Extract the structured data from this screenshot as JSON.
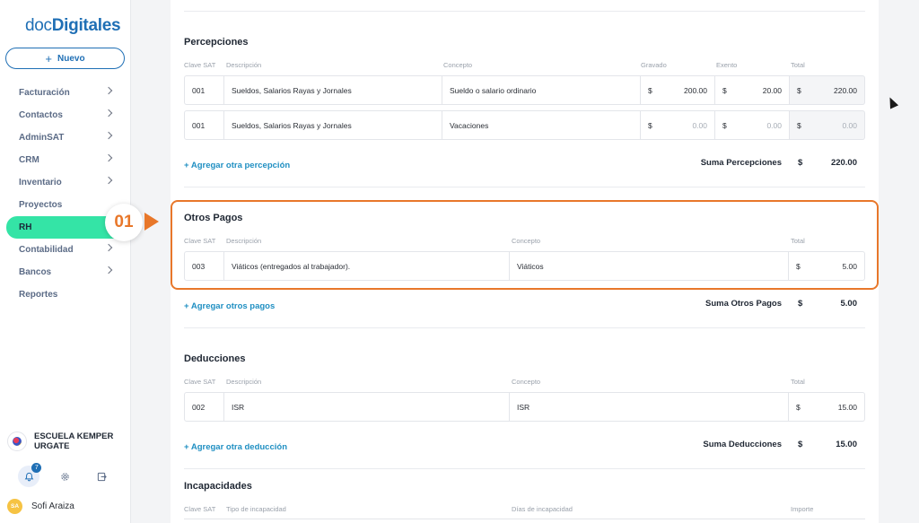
{
  "app": {
    "logo_part1": "doc",
    "logo_part2": "Digitales",
    "new_button": "Nuevo"
  },
  "sidebar": {
    "items": [
      {
        "label": "Facturación",
        "chevron": true
      },
      {
        "label": "Contactos",
        "chevron": true
      },
      {
        "label": "AdminSAT",
        "chevron": true
      },
      {
        "label": "CRM",
        "chevron": true
      },
      {
        "label": "Inventario",
        "chevron": true
      },
      {
        "label": "Proyectos",
        "chevron": false
      },
      {
        "label": "RH",
        "chevron": false,
        "active": true
      },
      {
        "label": "Contabilidad",
        "chevron": true
      },
      {
        "label": "Bancos",
        "chevron": true
      },
      {
        "label": "Reportes",
        "chevron": false
      }
    ],
    "step_badge": "01",
    "org_name": "ESCUELA KEMPER URGATE",
    "notifications_count": "7",
    "user_initials": "SA",
    "user_name": "Sofi Araiza"
  },
  "percepciones": {
    "title": "Percepciones",
    "headers": {
      "clave": "Clave SAT",
      "descripcion": "Descripción",
      "concepto": "Concepto",
      "gravado": "Gravado",
      "exento": "Exento",
      "total": "Total"
    },
    "rows": [
      {
        "clave": "001",
        "descripcion": "Sueldos, Salarios Rayas y Jornales",
        "concepto": "Sueldo o salario ordinario",
        "gravado_cur": "$",
        "gravado": "200.00",
        "exento_cur": "$",
        "exento": "20.00",
        "total_cur": "$",
        "total": "220.00"
      },
      {
        "clave": "001",
        "descripcion": "Sueldos, Salarios Rayas y Jornales",
        "concepto": "Vacaciones",
        "gravado_cur": "$",
        "gravado": "0.00",
        "exento_cur": "$",
        "exento": "0.00",
        "total_cur": "$",
        "total": "0.00"
      }
    ],
    "add_link": "+ Agregar otra percepción",
    "sum_label": "Suma Percepciones",
    "sum_cur": "$",
    "sum_value": "220.00"
  },
  "otros_pagos": {
    "title": "Otros Pagos",
    "headers": {
      "clave": "Clave SAT",
      "descripcion": "Descripción",
      "concepto": "Concepto",
      "total": "Total"
    },
    "rows": [
      {
        "clave": "003",
        "descripcion": "Viáticos (entregados al trabajador).",
        "concepto": "Viáticos",
        "total_cur": "$",
        "total": "5.00"
      }
    ],
    "add_link": "+ Agregar otros pagos",
    "sum_label": "Suma Otros Pagos",
    "sum_cur": "$",
    "sum_value": "5.00"
  },
  "deducciones": {
    "title": "Deducciones",
    "headers": {
      "clave": "Clave SAT",
      "descripcion": "Descripción",
      "concepto": "Concepto",
      "total": "Total"
    },
    "rows": [
      {
        "clave": "002",
        "descripcion": "ISR",
        "concepto": "ISR",
        "total_cur": "$",
        "total": "15.00"
      }
    ],
    "add_link": "+ Agregar otra deducción",
    "sum_label": "Suma Deducciones",
    "sum_cur": "$",
    "sum_value": "15.00"
  },
  "incapacidades": {
    "title": "Incapacidades",
    "headers": {
      "clave": "Clave SAT",
      "tipo": "Tipo de incapacidad",
      "dias": "Días de incapacidad",
      "importe": "Importe"
    }
  },
  "colors": {
    "accent": "#1f6fb5",
    "active_nav": "#34e4a6",
    "highlight": "#e8772a",
    "link": "#1f8fc2"
  }
}
